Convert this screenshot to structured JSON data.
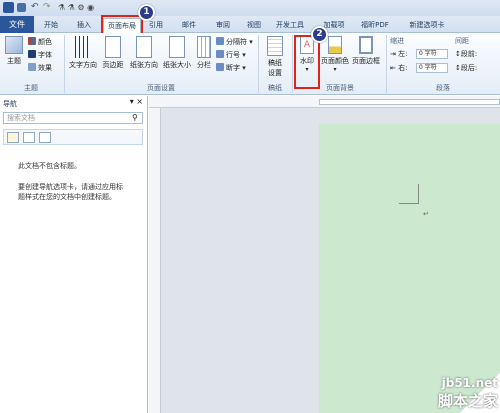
{
  "titlebar": {
    "qa_icons": [
      "word-icon",
      "save-icon",
      "undo-icon",
      "redo-icon"
    ]
  },
  "tabs": {
    "file": "文件",
    "items": [
      "开始",
      "插入",
      "页面布局",
      "引用",
      "邮件",
      "审阅",
      "视图",
      "开发工具",
      "加载项",
      "福昕PDF",
      "新建选项卡"
    ]
  },
  "ribbon": {
    "theme": {
      "main": "主题",
      "colors": "颜色",
      "fonts": "字体",
      "effects": "效果",
      "group": "主题"
    },
    "page_setup": {
      "text_dir": "文字方向",
      "margins": "页边距",
      "orientation": "纸张方向",
      "size": "纸张大小",
      "columns": "分栏",
      "breaks": "分隔符",
      "line_numbers": "行号",
      "hyphenation": "断字",
      "group": "页面设置"
    },
    "draft": {
      "label1": "稿纸",
      "label2": "设置",
      "group": "稿纸"
    },
    "background": {
      "watermark": "水印",
      "page_color": "页面颜色",
      "page_border": "页面边框",
      "group": "页面背景"
    },
    "paragraph": {
      "indent": "缩进",
      "spacing": "间距",
      "left_label": "左:",
      "left_value": "0 字符",
      "right_label": "右:",
      "right_value": "0 字符",
      "before_label": "段前:",
      "after_label": "段后:",
      "group": "段落"
    }
  },
  "nav": {
    "title": "导航",
    "close": "▾ ×",
    "search_placeholder": "搜索文档",
    "empty_line": "此文档不包含标题。",
    "hint_lines": [
      "要创建导航选项卡，请通过应用标",
      "题样式在您的文档中创建标题。"
    ]
  },
  "annotations": {
    "badge1": "1",
    "badge2": "2"
  },
  "watermark": {
    "site": "jb51.net",
    "brand": "脚本之家"
  },
  "colors": {
    "accent": "#2b579a",
    "page": "#cce8cf",
    "highlight": "#e2231a"
  }
}
